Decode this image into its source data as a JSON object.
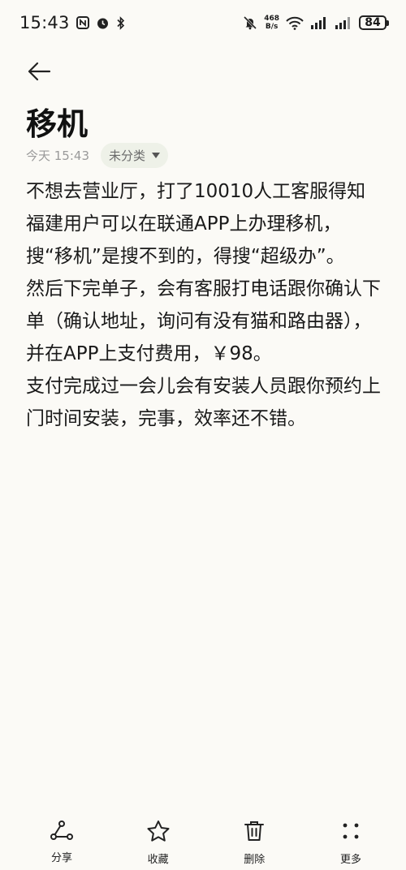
{
  "status_bar": {
    "time": "15:43",
    "net_speed_value": "468",
    "net_speed_unit": "B/s",
    "battery": "84",
    "icons": [
      "nfc-icon",
      "alarm-icon",
      "bluetooth-icon",
      "mute-icon",
      "wifi-icon",
      "signal-icon",
      "signal-icon-2"
    ]
  },
  "note": {
    "title": "移机",
    "date": "今天 15:43",
    "category": "未分类",
    "paragraphs": [
      "不想去营业厅，打了10010人工客服得知福建用户可以在联通APP上办理移机，搜“移机”是搜不到的，得搜“超级办”。",
      "然后下完单子，会有客服打电话跟你确认下单（确认地址，询问有没有猫和路由器），并在APP上支付费用，￥98。",
      "支付完成过一会儿会有安装人员跟你预约上门时间安装，完事，效率还不错。"
    ]
  },
  "toolbar": {
    "share_label": "分享",
    "favorite_label": "收藏",
    "delete_label": "删除",
    "more_label": "更多"
  },
  "colors": {
    "background": "#fbfaf6",
    "chip_background": "#eef1e8",
    "text": "#1a1a1a",
    "muted": "#9a9a9a"
  }
}
